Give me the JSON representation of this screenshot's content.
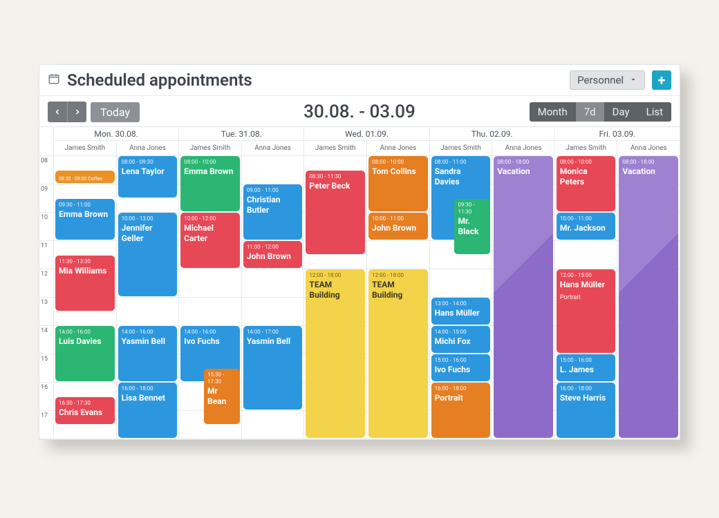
{
  "header": {
    "title": "Scheduled appointments",
    "personnel": "Personnel"
  },
  "toolbar": {
    "today": "Today",
    "range": "30.08. - 03.09",
    "views": [
      "Month",
      "7d",
      "Day",
      "List"
    ],
    "active_view": "7d"
  },
  "time_slots": [
    "08",
    "09",
    "10",
    "11",
    "12",
    "13",
    "14",
    "15",
    "16",
    "17"
  ],
  "days": [
    {
      "label": "Mon. 30.08.",
      "persons": [
        "James Smith",
        "Anna Jones"
      ]
    },
    {
      "label": "Tue. 31.08.",
      "persons": [
        "James Smith",
        "Anna Jones"
      ]
    },
    {
      "label": "Wed. 01.09.",
      "persons": [
        "James Smith",
        "Anna Jones"
      ]
    },
    {
      "label": "Thu. 02.09.",
      "persons": [
        "James Smith",
        "Anna Jones"
      ]
    },
    {
      "label": "Fri. 03.09.",
      "persons": [
        "James Smith",
        "Anna Jones"
      ]
    }
  ],
  "events": [
    {
      "day": 0,
      "col": 0,
      "start": 8.5,
      "end": 9,
      "time": "08:30 - 09:00",
      "name": "Coffee",
      "color": "orange",
      "tiny": true
    },
    {
      "day": 0,
      "col": 0,
      "start": 9.5,
      "end": 11,
      "time": "09:30 - 11:00",
      "name": "Emma Brown",
      "color": "blue"
    },
    {
      "day": 0,
      "col": 0,
      "start": 11.5,
      "end": 13.5,
      "time": "11:30 - 13:30",
      "name": "Mia Williams",
      "color": "red"
    },
    {
      "day": 0,
      "col": 0,
      "start": 14,
      "end": 16,
      "time": "14:00 - 16:00",
      "name": "Luis Davies",
      "color": "green"
    },
    {
      "day": 0,
      "col": 0,
      "start": 16.5,
      "end": 17.5,
      "time": "16:30 - 17:30",
      "name": "Chris Evans",
      "color": "red"
    },
    {
      "day": 0,
      "col": 1,
      "start": 8,
      "end": 9.5,
      "time": "08:00 - 09:30",
      "name": "Lena Taylor",
      "color": "blue"
    },
    {
      "day": 0,
      "col": 1,
      "start": 10,
      "end": 13,
      "time": "10:00 - 13:00",
      "name": "Jennifer Geller",
      "color": "blue"
    },
    {
      "day": 0,
      "col": 1,
      "start": 14,
      "end": 16,
      "time": "14:00 - 16:00",
      "name": "Yasmin Bell",
      "color": "blue"
    },
    {
      "day": 0,
      "col": 1,
      "start": 16,
      "end": 18,
      "time": "16:00 - 18:00",
      "name": "Lisa Bennet",
      "color": "blue"
    },
    {
      "day": 1,
      "col": 0,
      "start": 8,
      "end": 10,
      "time": "08:00 - 10:00",
      "name": "Emma Brown",
      "color": "green"
    },
    {
      "day": 1,
      "col": 0,
      "start": 10,
      "end": 12,
      "time": "10:00 - 12:00",
      "name": "Michael Carter",
      "color": "red"
    },
    {
      "day": 1,
      "col": 0,
      "start": 14,
      "end": 16,
      "time": "14:00 - 16:00",
      "name": "Ivo Fuchs",
      "color": "blue"
    },
    {
      "day": 1,
      "col": 0,
      "start": 15.5,
      "end": 17.5,
      "time": "15:30 - 17:30",
      "name": "Mr Bean",
      "color": "orange2",
      "half": "right"
    },
    {
      "day": 1,
      "col": 1,
      "start": 9,
      "end": 11,
      "time": "09:00 - 11:00",
      "name": "Christian Butler",
      "color": "blue"
    },
    {
      "day": 1,
      "col": 1,
      "start": 11,
      "end": 12,
      "time": "11:00 - 12:00",
      "name": "John Brown",
      "color": "red"
    },
    {
      "day": 1,
      "col": 1,
      "start": 14,
      "end": 17,
      "time": "14:00 - 17:00",
      "name": "Yasmin Bell",
      "color": "blue"
    },
    {
      "day": 2,
      "col": 0,
      "start": 8.5,
      "end": 11.5,
      "time": "08:30 - 11:30",
      "name": "Peter Beck",
      "color": "red"
    },
    {
      "day": 2,
      "col": 0,
      "start": 12,
      "end": 18,
      "time": "12:00 - 18:00",
      "name": "TEAM Building",
      "color": "yellow"
    },
    {
      "day": 2,
      "col": 1,
      "start": 8,
      "end": 10,
      "time": "08:00 - 10:00",
      "name": "Tom Collins",
      "color": "orange2"
    },
    {
      "day": 2,
      "col": 1,
      "start": 10,
      "end": 11,
      "time": "10:00 - 11:00",
      "name": "John Brown",
      "color": "orange2"
    },
    {
      "day": 2,
      "col": 1,
      "start": 12,
      "end": 18,
      "time": "12:00 - 18:00",
      "name": "TEAM Building",
      "color": "yellow"
    },
    {
      "day": 3,
      "col": 0,
      "start": 8,
      "end": 11,
      "time": "08:00 - 11:00",
      "name": "Sandra Davies",
      "color": "blue"
    },
    {
      "day": 3,
      "col": 0,
      "start": 9.5,
      "end": 11.5,
      "time": "09:30 - 11:30",
      "name": "Mr. Black",
      "color": "green",
      "half": "right"
    },
    {
      "day": 3,
      "col": 0,
      "start": 13,
      "end": 14,
      "time": "13:00 - 14:00",
      "name": "Hans Müller",
      "color": "blue"
    },
    {
      "day": 3,
      "col": 0,
      "start": 14,
      "end": 15,
      "time": "14:00 - 15:00",
      "name": "Michi Fox",
      "color": "blue"
    },
    {
      "day": 3,
      "col": 0,
      "start": 15,
      "end": 16,
      "time": "15:00 - 16:00",
      "name": "Ivo Fuchs",
      "color": "blue"
    },
    {
      "day": 3,
      "col": 0,
      "start": 16,
      "end": 18,
      "time": "16:00 - 18:00",
      "name": "Portrait",
      "color": "orange2",
      "sub": ""
    },
    {
      "day": 3,
      "col": 1,
      "start": 8,
      "end": 18,
      "time": "08:00 - 18:00",
      "name": "Vacation",
      "color": "purple"
    },
    {
      "day": 4,
      "col": 0,
      "start": 8,
      "end": 10,
      "time": "08:00 - 10:00",
      "name": "Monica Peters",
      "color": "red"
    },
    {
      "day": 4,
      "col": 0,
      "start": 10,
      "end": 11,
      "time": "10:00 - 11:00",
      "name": "Mr. Jackson",
      "color": "blue"
    },
    {
      "day": 4,
      "col": 0,
      "start": 12,
      "end": 15,
      "time": "12:00 - 15:00",
      "name": "Hans Müller",
      "color": "red",
      "sub": "Portrait"
    },
    {
      "day": 4,
      "col": 0,
      "start": 15,
      "end": 16,
      "time": "15:00 - 16:00",
      "name": "L. James",
      "color": "blue"
    },
    {
      "day": 4,
      "col": 0,
      "start": 16,
      "end": 18,
      "time": "16:00 - 18:00",
      "name": "Steve Harris",
      "color": "blue"
    },
    {
      "day": 4,
      "col": 1,
      "start": 8,
      "end": 18,
      "time": "08:00 - 18:00",
      "name": "Vacation",
      "color": "purple"
    }
  ]
}
